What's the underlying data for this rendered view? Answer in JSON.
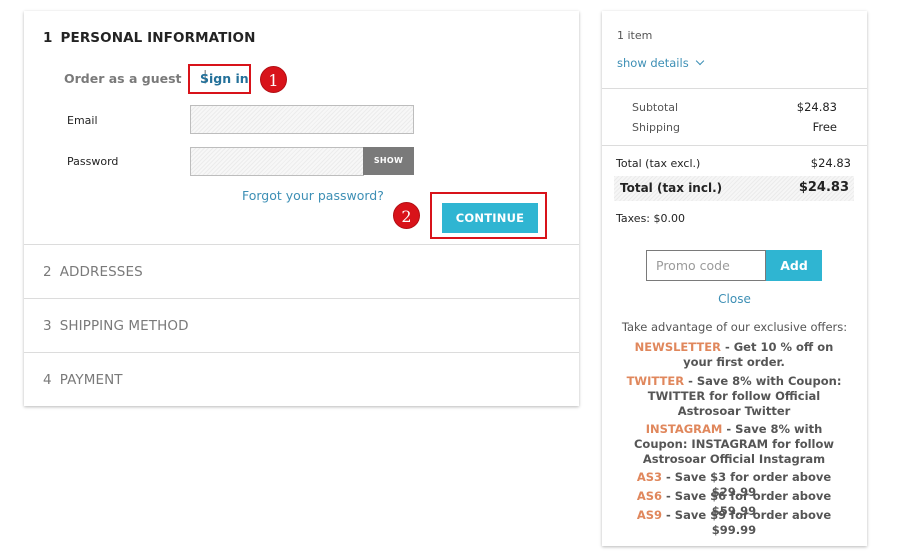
{
  "checkout": {
    "steps": [
      {
        "num": "1",
        "title": "PERSONAL INFORMATION"
      },
      {
        "num": "2",
        "title": "ADDRESSES"
      },
      {
        "num": "3",
        "title": "SHIPPING METHOD"
      },
      {
        "num": "4",
        "title": "PAYMENT"
      }
    ],
    "guest_label": "Order as a guest",
    "separator": "|",
    "sign_in_label": "Sign in",
    "email_label": "Email",
    "email_value": "",
    "password_label": "Password",
    "password_value": "",
    "show_label": "SHOW",
    "forgot_label": "Forgot your password?",
    "continue_label": "CONTINUE",
    "annotations": {
      "badge1": "1",
      "badge2": "2",
      "highlight_color": "#d8131a"
    }
  },
  "summary": {
    "item_count": "1 item",
    "show_details_label": "show details",
    "subtotal_label": "Subtotal",
    "subtotal_value": "$24.83",
    "shipping_label": "Shipping",
    "shipping_value": "Free",
    "total_excl_label": "Total (tax excl.)",
    "total_excl_value": "$24.83",
    "total_incl_label": "Total (tax incl.)",
    "total_incl_value": "$24.83",
    "taxes_label": "Taxes: $0.00",
    "promo_placeholder": "Promo code",
    "add_label": "Add",
    "close_label": "Close",
    "offers_heading": "Take advantage of our exclusive offers:",
    "offers": [
      {
        "code": "NEWSLETTER",
        "desc": " - Get 10 % off on your first order."
      },
      {
        "code": "TWITTER",
        "desc": " - Save 8% with Coupon: TWITTER for follow Official Astrosoar Twitter"
      },
      {
        "code": "INSTAGRAM",
        "desc": " - Save 8% with Coupon: INSTAGRAM for follow Astrosoar Official Instagram"
      },
      {
        "code": "AS3",
        "desc": " - Save $3 for order above $29.99"
      },
      {
        "code": "AS6",
        "desc": " - Save $6 for order above $59.99"
      },
      {
        "code": "AS9",
        "desc": " - Save $9 for order above $99.99"
      }
    ]
  },
  "colors": {
    "accent": "#2fb5d2",
    "link": "#3d8fb5",
    "offer_code": "#e0875c"
  }
}
